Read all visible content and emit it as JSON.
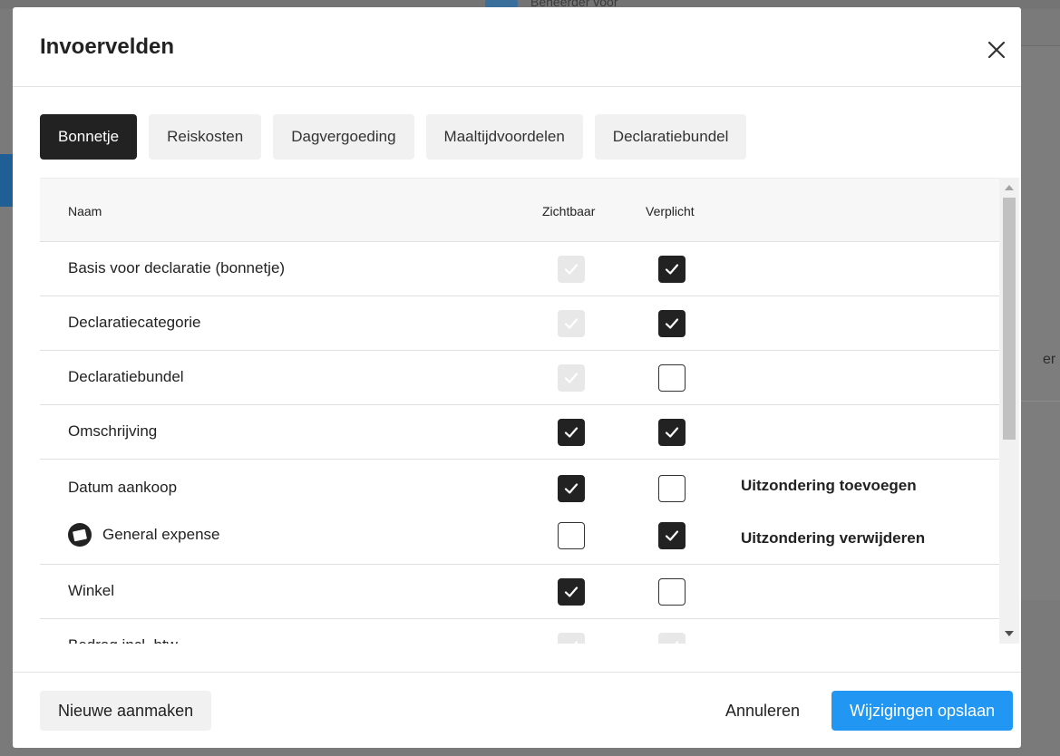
{
  "background": {
    "hint_text": "Beheerder voor",
    "right_text": "er"
  },
  "modal": {
    "title": "Invoervelden",
    "close_icon": "close-icon"
  },
  "tabs": [
    {
      "label": "Bonnetje",
      "active": true
    },
    {
      "label": "Reiskosten",
      "active": false
    },
    {
      "label": "Dagvergoeding",
      "active": false
    },
    {
      "label": "Maaltijdvoordelen",
      "active": false
    },
    {
      "label": "Declaratiebundel",
      "active": false
    }
  ],
  "table": {
    "headers": {
      "name": "Naam",
      "visible": "Zichtbaar",
      "required": "Verplicht"
    },
    "rows": [
      {
        "name": "Basis voor declaratie (bonnetje)",
        "visible": "disabled-checked",
        "required": "checked"
      },
      {
        "name": "Declaratiecategorie",
        "visible": "disabled-checked",
        "required": "checked"
      },
      {
        "name": "Declaratiebundel",
        "visible": "disabled-checked",
        "required": "unchecked"
      },
      {
        "name": "Omschrijving",
        "visible": "checked",
        "required": "checked"
      },
      {
        "name": "Datum aankoop",
        "visible": "checked",
        "required": "unchecked",
        "action": "Uitzondering toevoegen",
        "exception": {
          "name": "General expense",
          "icon": "receipt-icon",
          "visible": "unchecked",
          "required": "checked",
          "action": "Uitzondering verwijderen"
        }
      },
      {
        "name": "Winkel",
        "visible": "checked",
        "required": "unchecked"
      },
      {
        "name": "Bedrag incl. btw",
        "visible": "disabled-checked",
        "required": "disabled-checked"
      }
    ]
  },
  "footer": {
    "new_label": "Nieuwe aanmaken",
    "cancel_label": "Annuleren",
    "save_label": "Wijzigingen opslaan"
  },
  "colors": {
    "primary": "#2196f3",
    "active_tab": "#222222",
    "overlay": "#7a7a7a"
  }
}
